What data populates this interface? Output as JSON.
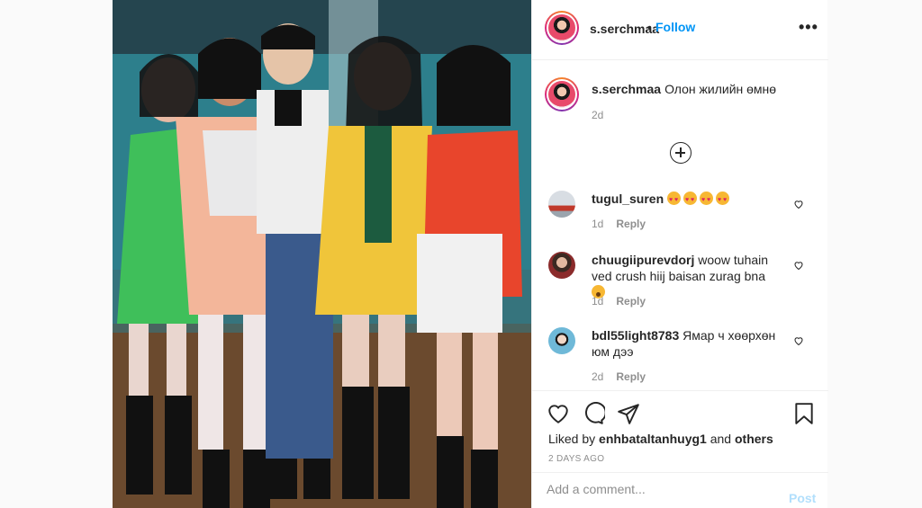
{
  "post": {
    "username": "s.serchmaa",
    "follow_label": "Follow",
    "separator": "•",
    "more_label": "•••",
    "caption": "Олон жилийн өмнө",
    "caption_time": "2d"
  },
  "comments": [
    {
      "username": "tugul_suren",
      "text": "",
      "emoji": "heart-eyes-emoji x4",
      "time": "1d",
      "reply": "Reply"
    },
    {
      "username": "chuugiipurevdorj",
      "text": "woow tuhain ved crush hiij baisan zurag bna",
      "emoji": "astonished-emoji",
      "time": "1d",
      "reply": "Reply"
    },
    {
      "username": "bdl55light8783",
      "text": "Ямар ч хөөрхөн юм дээ",
      "emoji": "",
      "time": "2d",
      "reply": "Reply"
    }
  ],
  "actions": {
    "liked_prefix": "Liked by",
    "liked_user": "enhbataltanhuyg1",
    "liked_and": "and",
    "liked_others": "others",
    "date": "2 DAYS AGO"
  },
  "add_comment": {
    "placeholder": "Add a comment...",
    "post_label": "Post"
  },
  "colors": {
    "link_blue": "#0095f6",
    "muted": "#8e8e8e",
    "post_disabled": "#b2dffc",
    "divider": "#efefef"
  },
  "icons": [
    "heart-icon",
    "comment-icon",
    "share-icon",
    "bookmark-icon",
    "more-options-icon",
    "load-more-icon"
  ]
}
